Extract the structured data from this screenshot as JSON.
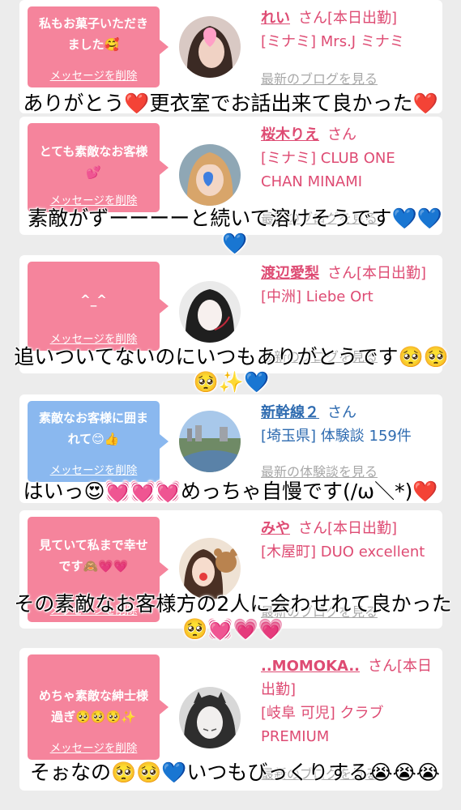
{
  "cards": [
    {
      "message": "私もお菓子いただきました🥰",
      "delete_label": "メッセージを削除",
      "name": "れい",
      "san": "さん[本日出勤]",
      "shop": "[ミナミ] Mrs.J ミナミ",
      "link": "最新のブログを見る"
    },
    {
      "message": "とても素敵なお客様💕",
      "delete_label": "メッセージを削除",
      "name": "桜木りえ",
      "san": "さん",
      "shop": "[ミナミ] CLUB ONE CHAN MINAMI",
      "link": "最新のブログを見る"
    },
    {
      "message": "^_^",
      "delete_label": "メッセージを削除",
      "name": "渡辺愛梨",
      "san": "さん[本日出勤]",
      "shop": "[中洲] Liebe Ort",
      "link": "最新のブログを見る"
    },
    {
      "message": "素敵なお客様に囲まれて😊👍",
      "delete_label": "メッセージを削除",
      "name": "新幹線２",
      "san": "さん",
      "shop": "[埼玉県] 体験談 159件",
      "link": "最新の体験談を見る"
    },
    {
      "message": "見ていて私まで幸せです🙈💗💗",
      "delete_label": "メッセージを削除",
      "name": "みや",
      "san": "さん[本日出勤]",
      "shop": "[木屋町] DUO excellent",
      "link": "最新のブログを見る"
    },
    {
      "message": "めちゃ素敵な紳士様過ぎ🥺🥺🥺✨",
      "delete_label": "メッセージを削除",
      "name": "..MOMOKA..",
      "san": "さん[本日出勤]",
      "shop": "[岐阜 可児] クラブ PREMIUM",
      "link": "最新のブログを見る"
    }
  ],
  "overlays": [
    "ありがとう❤️更衣室でお話出来て良かった❤️",
    "素敵がずーーーーと続いて溶けそうです💙💙💙",
    "追いついてないのにいつもありがとうです🥺🥺🥺✨💙",
    "はいっ😍💓💓💓めっちゃ自慢です(/ω＼*)❤️",
    "その素敵なお客様方の2人に会わせれて良かった🥺💓💗💗",
    "そぉなの🥺🥺💙いつもびっくりする😭😭😭"
  ],
  "colors": {
    "pink_bubble": "#f5849c",
    "blue_bubble": "#8ab8ef",
    "pink_name": "#de4b73",
    "blue_name": "#2e6bb0",
    "link_gray": "#a8a8a8"
  }
}
